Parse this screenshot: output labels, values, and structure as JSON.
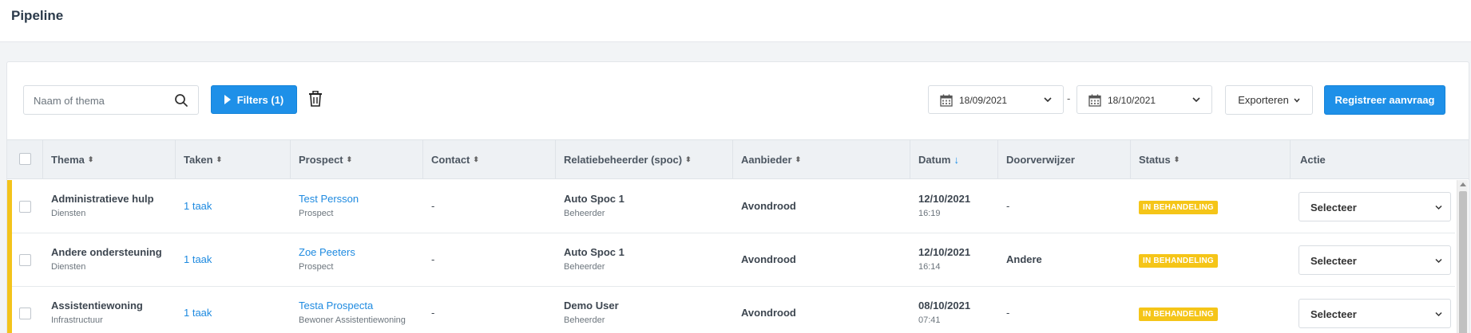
{
  "header": {
    "title": "Pipeline"
  },
  "toolbar": {
    "search_placeholder": "Naam of thema",
    "filters_label": "Filters (1)",
    "date_from": "18/09/2021",
    "date_separator": "-",
    "date_to": "18/10/2021",
    "export_label": "Exporteren",
    "register_label": "Registreer aanvraag"
  },
  "table": {
    "columns": {
      "thema": "Thema",
      "taken": "Taken",
      "prospect": "Prospect",
      "contact": "Contact",
      "relatiebeheerder": "Relatiebeheerder (spoc)",
      "aanbieder": "Aanbieder",
      "datum": "Datum",
      "doorverwijzer": "Doorverwijzer",
      "status": "Status",
      "actie": "Actie"
    },
    "sort_glyph": "⬍",
    "sort_desc_glyph": "↓",
    "rows": [
      {
        "thema": "Administratieve hulp",
        "thema_sub": "Diensten",
        "taken": "1 taak",
        "prospect": "Test Persson",
        "prospect_sub": "Prospect",
        "contact": "-",
        "spoc": "Auto Spoc 1",
        "spoc_sub": "Beheerder",
        "aanbieder": "Avondrood",
        "datum": "12/10/2021",
        "tijd": "16:19",
        "doorverwijzer": "-",
        "status": "IN BEHANDELING",
        "actie": "Selecteer"
      },
      {
        "thema": "Andere ondersteuning",
        "thema_sub": "Diensten",
        "taken": "1 taak",
        "prospect": "Zoe Peeters",
        "prospect_sub": "Prospect",
        "contact": "-",
        "spoc": "Auto Spoc 1",
        "spoc_sub": "Beheerder",
        "aanbieder": "Avondrood",
        "datum": "12/10/2021",
        "tijd": "16:14",
        "doorverwijzer": "Andere",
        "status": "IN BEHANDELING",
        "actie": "Selecteer"
      },
      {
        "thema": "Assistentiewoning",
        "thema_sub": "Infrastructuur",
        "taken": "1 taak",
        "prospect": "Testa Prospecta",
        "prospect_sub": "Bewoner Assistentiewoning",
        "contact": "-",
        "spoc": "Demo User",
        "spoc_sub": "Beheerder",
        "aanbieder": "Avondrood",
        "datum": "08/10/2021",
        "tijd": "07:41",
        "doorverwijzer": "-",
        "status": "IN BEHANDELING",
        "actie": "Selecteer"
      }
    ]
  },
  "colors": {
    "primary": "#1e90e8",
    "status_badge": "#f5c518",
    "row_accent": "#f3c31b",
    "link": "#1e8ae0"
  }
}
